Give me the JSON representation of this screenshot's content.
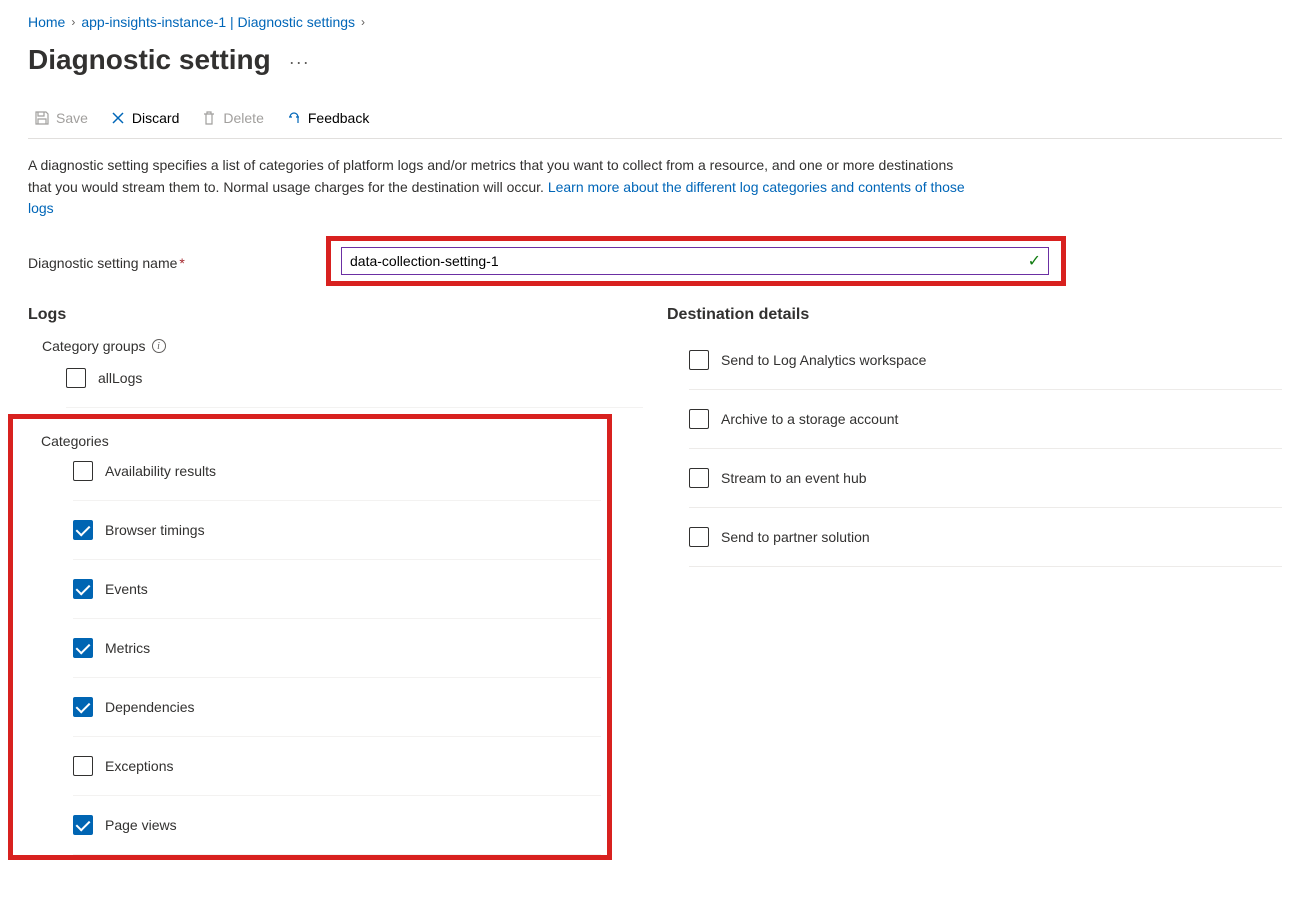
{
  "breadcrumb": {
    "home": "Home",
    "resource": "app-insights-instance-1 | Diagnostic settings"
  },
  "page": {
    "title": "Diagnostic setting",
    "more": "···"
  },
  "toolbar": {
    "save": "Save",
    "discard": "Discard",
    "delete": "Delete",
    "feedback": "Feedback"
  },
  "description": {
    "text1": "A diagnostic setting specifies a list of categories of platform logs and/or metrics that you want to collect from a resource, and one or more destinations that you would stream them to. Normal usage charges for the destination will occur. ",
    "link": "Learn more about the different log categories and contents of those logs"
  },
  "settingName": {
    "label": "Diagnostic setting name",
    "value": "data-collection-setting-1"
  },
  "logs": {
    "heading": "Logs",
    "categoryGroups": "Category groups",
    "allLogs": "allLogs",
    "categoriesHeading": "Categories",
    "categories": [
      {
        "label": "Availability results",
        "checked": false
      },
      {
        "label": "Browser timings",
        "checked": true
      },
      {
        "label": "Events",
        "checked": true
      },
      {
        "label": "Metrics",
        "checked": true
      },
      {
        "label": "Dependencies",
        "checked": true
      },
      {
        "label": "Exceptions",
        "checked": false
      },
      {
        "label": "Page views",
        "checked": true
      }
    ]
  },
  "destinations": {
    "heading": "Destination details",
    "items": [
      {
        "label": "Send to Log Analytics workspace"
      },
      {
        "label": "Archive to a storage account"
      },
      {
        "label": "Stream to an event hub"
      },
      {
        "label": "Send to partner solution"
      }
    ]
  }
}
